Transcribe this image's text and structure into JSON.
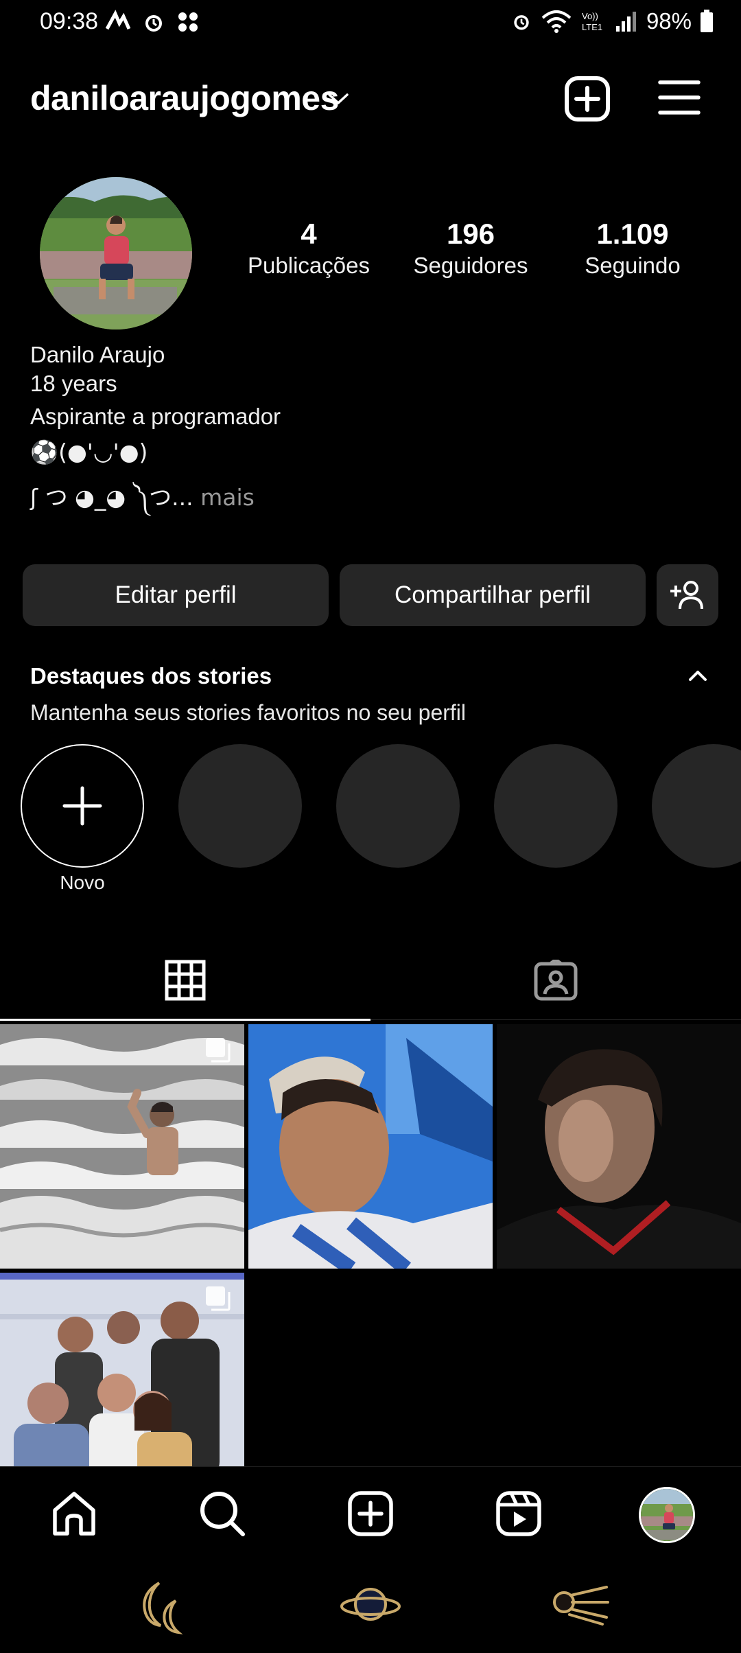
{
  "status_bar": {
    "time": "09:38",
    "battery": "98%",
    "left_icons": [
      "activity-icon",
      "alarm-icon",
      "grid-app-icon"
    ],
    "right_icons": [
      "alarm-icon",
      "wifi-icon",
      "volte-icon",
      "signal-icon",
      "battery-icon"
    ]
  },
  "header": {
    "username": "daniloaraujogomes",
    "chevron_icon": "chevron-down-icon",
    "add_icon": "add-square-icon",
    "menu_icon": "hamburger-menu-icon"
  },
  "profile": {
    "stats": [
      {
        "value": "4",
        "label": "Publicações"
      },
      {
        "value": "196",
        "label": "Seguidores"
      },
      {
        "value": "1.109",
        "label": "Seguindo"
      }
    ],
    "bio": {
      "name": "Danilo Araujo",
      "line1": "18 years",
      "line2": "Aspirante a programador",
      "line3": "⚽(●'◡'●)",
      "line4": "ʃ つ ◕_◕ ༽つ...",
      "more": " mais"
    }
  },
  "actions": {
    "edit": "Editar perfil",
    "share": "Compartilhar perfil",
    "discover_icon": "add-person-icon"
  },
  "highlights": {
    "title": "Destaques dos stories",
    "subtitle": "Mantenha seus stories favoritos no seu perfil",
    "new_label": "Novo",
    "chevron_icon": "chevron-up-icon"
  },
  "tabs": [
    {
      "icon": "grid-icon",
      "active": true
    },
    {
      "icon": "tagged-icon",
      "active": false
    }
  ],
  "posts": [
    {
      "name": "post-beach",
      "multi": true
    },
    {
      "name": "post-selfie-blue",
      "multi": false
    },
    {
      "name": "post-dark-portrait",
      "multi": false
    },
    {
      "name": "post-group",
      "multi": true
    }
  ],
  "bottom_nav": [
    "home-icon",
    "search-icon",
    "create-icon",
    "reels-icon",
    "profile-avatar"
  ],
  "gesture_bar": [
    "moon-icon",
    "planet-icon",
    "comet-icon"
  ],
  "colors": {
    "background": "#000000",
    "button": "#262626",
    "text": "#f5f5f5",
    "muted": "#9a9a9a",
    "gesture_gold": "#c9a96a"
  }
}
